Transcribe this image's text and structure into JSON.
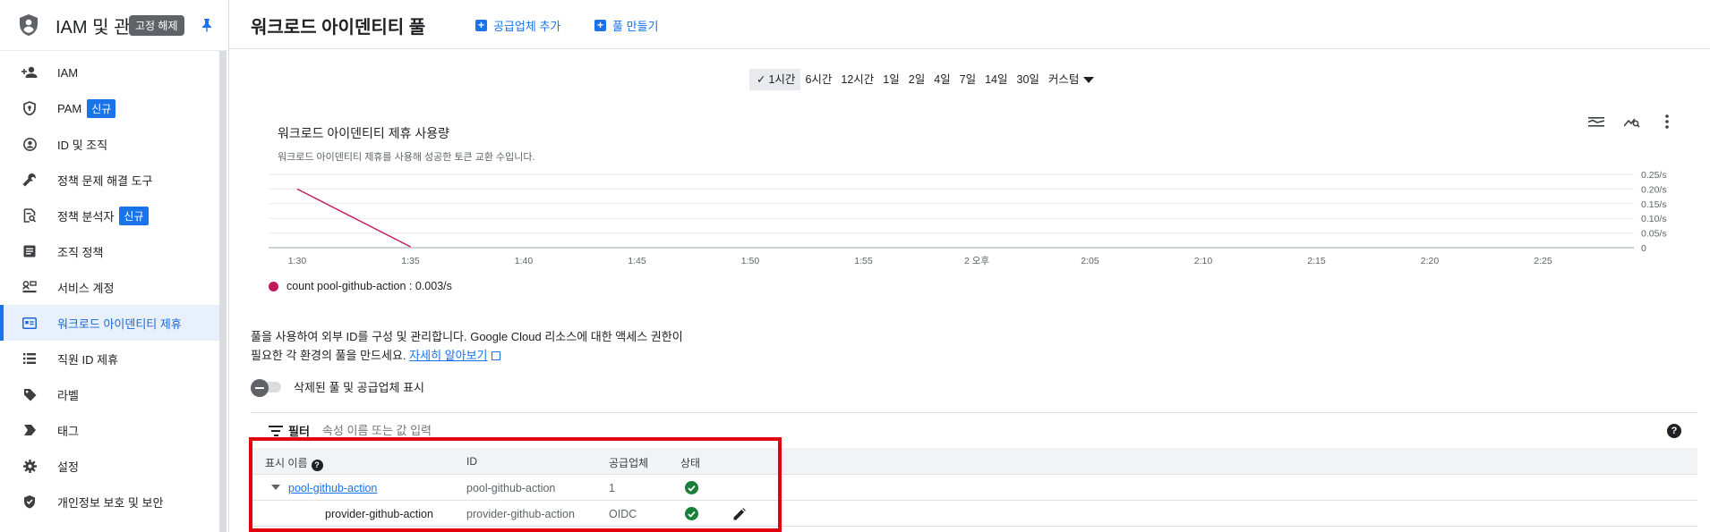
{
  "sidebar": {
    "title": "IAM 및 관",
    "pin_tooltip": "고정 해제",
    "items": [
      {
        "label": "IAM",
        "icon": "person-add-icon"
      },
      {
        "label": "PAM",
        "icon": "shield-icon",
        "badge": "신규"
      },
      {
        "label": "ID 및 조직",
        "icon": "account-circle-icon"
      },
      {
        "label": "정책 문제 해결 도구",
        "icon": "wrench-icon"
      },
      {
        "label": "정책 분석자",
        "icon": "policy-search-icon",
        "badge": "신규"
      },
      {
        "label": "조직 정책",
        "icon": "article-icon"
      },
      {
        "label": "서비스 계정",
        "icon": "service-account-icon"
      },
      {
        "label": "워크로드 아이덴티티 제휴",
        "icon": "id-card-icon",
        "active": true
      },
      {
        "label": "직원 ID 제휴",
        "icon": "list-icon"
      },
      {
        "label": "라벨",
        "icon": "label-icon"
      },
      {
        "label": "태그",
        "icon": "tag-icon"
      },
      {
        "label": "설정",
        "icon": "gear-icon"
      },
      {
        "label": "개인정보 보호 및 보안",
        "icon": "privacy-shield-icon"
      }
    ]
  },
  "header": {
    "title": "워크로드 아이덴티티 풀",
    "add_provider_label": "공급업체 추가",
    "create_pool_label": "풀 만들기"
  },
  "time_range": {
    "options": [
      "1시간",
      "6시간",
      "12시간",
      "1일",
      "2일",
      "4일",
      "7일",
      "14일",
      "30일",
      "커스텀"
    ],
    "selected": "1시간"
  },
  "chart": {
    "title": "워크로드 아이덴티티 제휴 사용량",
    "subtitle": "워크로드 아이덴티티 제휴를 사용해 성공한 토큰 교환 수입니다."
  },
  "chart_data": {
    "type": "line",
    "x_ticks": [
      "1:30",
      "1:35",
      "1:40",
      "1:45",
      "1:50",
      "1:55",
      "2 오후",
      "2:05",
      "2:10",
      "2:15",
      "2:20",
      "2:25"
    ],
    "y_ticks": [
      "0",
      "0.05/s",
      "0.10/s",
      "0.15/s",
      "0.20/s",
      "0.25/s"
    ],
    "ylim": [
      0,
      0.25
    ],
    "series": [
      {
        "name": "count pool-github-action",
        "color": "#c2185b",
        "x_minutes": [
          0,
          5
        ],
        "values": [
          0.2,
          0.003
        ]
      }
    ],
    "legend_value": "0.003/s",
    "grid": true
  },
  "description": {
    "line1": "풀을 사용하여 외부 ID를 구성 및 관리합니다. Google Cloud 리소스에 대한 액세스 권한이",
    "line2_prefix": "필요한 각 환경의 풀을 만드세요. ",
    "learn_more": "자세히 알아보기",
    "toggle_label": "삭제된 풀 및 공급업체 표시"
  },
  "table": {
    "filter_label": "필터",
    "filter_placeholder": "속성 이름 또는 값 입력",
    "columns": [
      "표시 이름",
      "ID",
      "공급업체",
      "상태"
    ],
    "rows": [
      {
        "name": "pool-github-action",
        "id": "pool-github-action",
        "providers": "1",
        "status": "ok",
        "is_pool": true
      },
      {
        "name": "provider-github-action",
        "id": "provider-github-action",
        "providers": "OIDC",
        "status": "ok",
        "is_pool": false
      }
    ]
  }
}
